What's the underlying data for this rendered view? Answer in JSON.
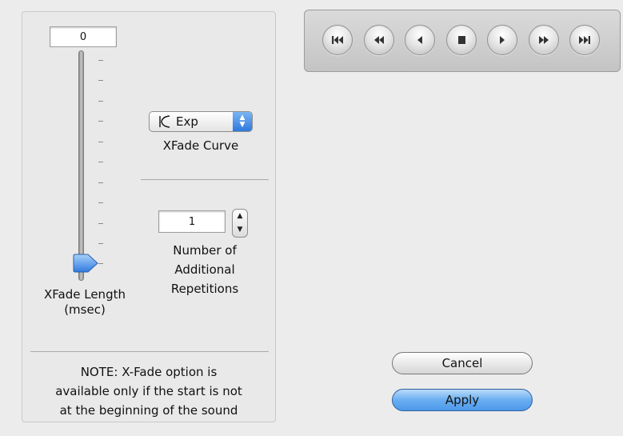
{
  "xfade": {
    "length_value": "0",
    "length_label_line1": "XFade Length",
    "length_label_line2": "(msec)",
    "curve_selected": "Exp",
    "curve_label": "XFade Curve",
    "repetitions_value": "1",
    "repetitions_label_line1": "Number of",
    "repetitions_label_line2": "Additional",
    "repetitions_label_line3": "Repetitions",
    "note_line1": "NOTE: X-Fade option is",
    "note_line2": "available only if the start is not",
    "note_line3": "at the beginning of the sound"
  },
  "transport": {
    "buttons": [
      "skip-to-start-icon",
      "rewind-icon",
      "step-back-icon",
      "stop-icon",
      "play-icon",
      "fast-forward-icon",
      "skip-to-end-icon"
    ]
  },
  "actions": {
    "cancel_label": "Cancel",
    "apply_label": "Apply"
  },
  "colors": {
    "accent_blue": "#4c99ea",
    "panel_background": "#ececec"
  }
}
